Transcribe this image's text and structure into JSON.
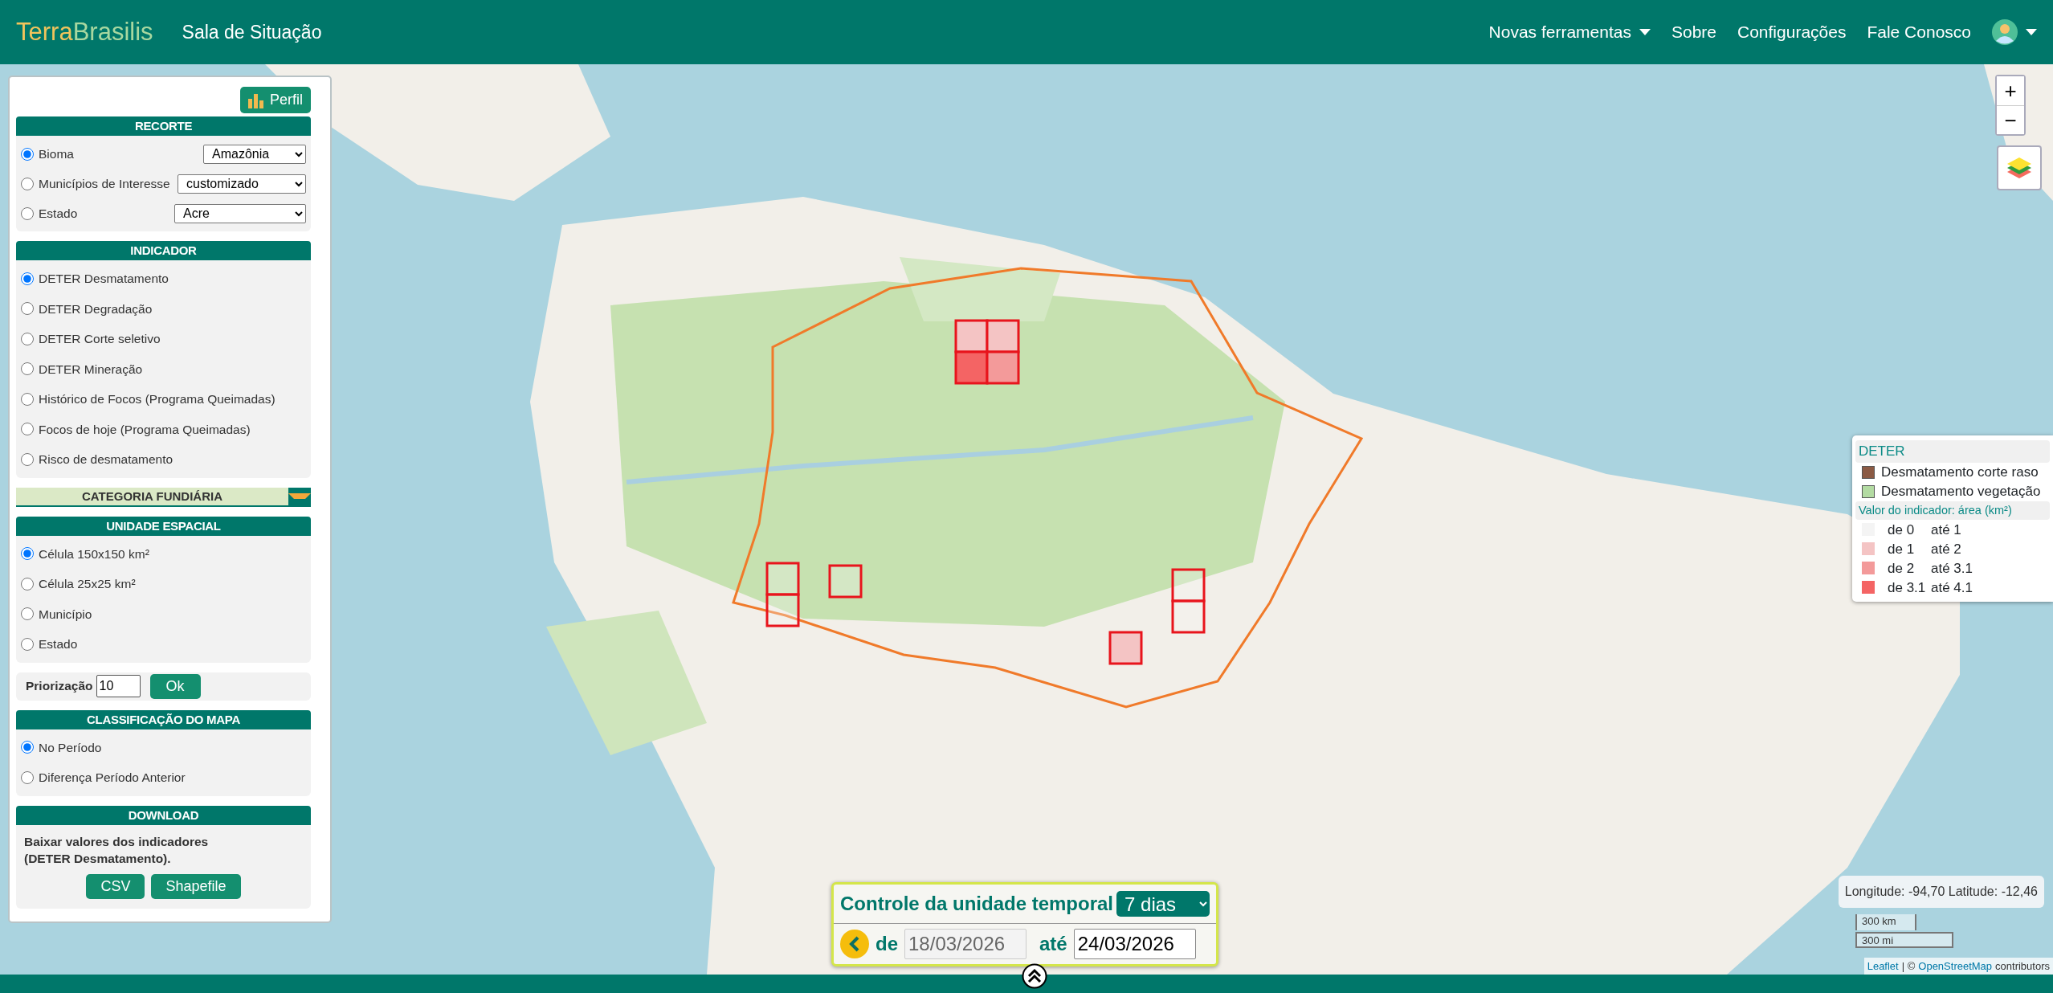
{
  "navbar": {
    "brand_first": "Terra",
    "brand_second": "Brasilis",
    "title": "Sala de Situação",
    "menu": [
      {
        "label": "Novas ferramentas",
        "dropdown": true
      },
      {
        "label": "Sobre",
        "dropdown": false
      },
      {
        "label": "Configurações",
        "dropdown": false
      },
      {
        "label": "Fale Conosco",
        "dropdown": false
      }
    ],
    "user_menu": {
      "dropdown": true
    }
  },
  "sidebar": {
    "profile_button": "Perfil",
    "recorte": {
      "title": "RECORTE",
      "options": [
        {
          "label": "Bioma",
          "selected": true,
          "select_value": "Amazônia"
        },
        {
          "label": "Municípios de Interesse",
          "selected": false,
          "select_value": "customizado"
        },
        {
          "label": "Estado",
          "selected": false,
          "select_value": "Acre"
        }
      ]
    },
    "indicador": {
      "title": "INDICADOR",
      "options": [
        {
          "label": "DETER Desmatamento",
          "selected": true
        },
        {
          "label": "DETER Degradação",
          "selected": false
        },
        {
          "label": "DETER Corte seletivo",
          "selected": false
        },
        {
          "label": "DETER Mineração",
          "selected": false
        },
        {
          "label": "Histórico de Focos (Programa Queimadas)",
          "selected": false
        },
        {
          "label": "Focos de hoje (Programa Queimadas)",
          "selected": false
        },
        {
          "label": "Risco de desmatamento",
          "selected": false
        }
      ]
    },
    "categoria_fundiaria": {
      "title": "CATEGORIA FUNDIÁRIA",
      "expanded": false
    },
    "unidade_espacial": {
      "title": "UNIDADE ESPACIAL",
      "options": [
        {
          "label": "Célula 150x150 km²",
          "selected": true
        },
        {
          "label": "Célula 25x25 km²",
          "selected": false
        },
        {
          "label": "Município",
          "selected": false
        },
        {
          "label": "Estado",
          "selected": false
        }
      ]
    },
    "priorizacao": {
      "label": "Priorização",
      "value": "10",
      "button": "Ok"
    },
    "classificacao": {
      "title": "CLASSIFICAÇÃO DO MAPA",
      "options": [
        {
          "label": "No Período",
          "selected": true
        },
        {
          "label": "Diferença Período Anterior",
          "selected": false
        }
      ]
    },
    "download": {
      "title": "DOWNLOAD",
      "text": "Baixar valores dos indicadores\n(DETER Desmatamento).",
      "buttons": [
        "CSV",
        "Shapefile"
      ]
    }
  },
  "map": {
    "zoom_controls": [
      "+",
      "−"
    ],
    "legend": {
      "title": "DETER",
      "classes": [
        {
          "label": "Desmatamento corte raso",
          "color": "#8b5a44"
        },
        {
          "label": "Desmatamento vegetação",
          "color": "#b3dba2"
        }
      ],
      "value_title": "Valor do indicador: área (km²)",
      "ranges": [
        {
          "from": "de 0",
          "to": "até 1",
          "color": "#f4f4f4"
        },
        {
          "from": "de 1",
          "to": "até 2",
          "color": "#f4c4c4"
        },
        {
          "from": "de 2",
          "to": "até 3.1",
          "color": "#f39a9a"
        },
        {
          "from": "de 3.1",
          "to": "até 4.1",
          "color": "#f46464"
        }
      ]
    },
    "coordinates": "Longitude: -94,70 Latitude: -12,46",
    "scale": [
      "300 km",
      "300 mi"
    ],
    "attribution": {
      "link_first": "Leaflet",
      "separator": "| ©",
      "link_second": "OpenStreetMap",
      "suffix": "contributors"
    },
    "temporal_control": {
      "title": "Controle da unidade temporal",
      "unit": "7 dias",
      "from_label": "de",
      "from_date": "18/03/2026",
      "from_disabled": true,
      "to_label": "até",
      "to_date": "24/03/2026"
    }
  }
}
